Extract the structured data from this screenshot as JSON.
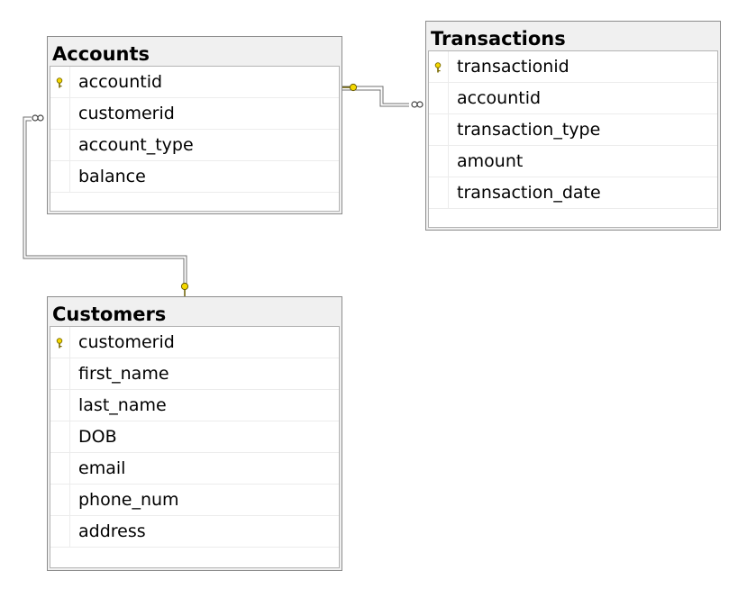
{
  "tables": {
    "accounts": {
      "title": "Accounts",
      "columns": [
        {
          "name": "accountid",
          "primary_key": true
        },
        {
          "name": "customerid",
          "primary_key": false
        },
        {
          "name": "account_type",
          "primary_key": false
        },
        {
          "name": "balance",
          "primary_key": false
        }
      ]
    },
    "transactions": {
      "title": "Transactions",
      "columns": [
        {
          "name": "transactionid",
          "primary_key": true
        },
        {
          "name": "accountid",
          "primary_key": false
        },
        {
          "name": "transaction_type",
          "primary_key": false
        },
        {
          "name": "amount",
          "primary_key": false
        },
        {
          "name": "transaction_date",
          "primary_key": false
        }
      ]
    },
    "customers": {
      "title": "Customers",
      "columns": [
        {
          "name": "customerid",
          "primary_key": true
        },
        {
          "name": "first_name",
          "primary_key": false
        },
        {
          "name": "last_name",
          "primary_key": false
        },
        {
          "name": "DOB",
          "primary_key": false
        },
        {
          "name": "email",
          "primary_key": false
        },
        {
          "name": "phone_num",
          "primary_key": false
        },
        {
          "name": "address",
          "primary_key": false
        }
      ]
    }
  },
  "relationships": [
    {
      "from": "Accounts",
      "from_end": "key",
      "to": "Transactions",
      "to_end": "many"
    },
    {
      "from": "Customers",
      "from_end": "key",
      "to": "Accounts",
      "to_end": "many"
    }
  ],
  "colors": {
    "header_bg": "#f0f0f0",
    "border": "#8c8c8c",
    "key_icon": "#f5d800",
    "connector": "#707070"
  }
}
